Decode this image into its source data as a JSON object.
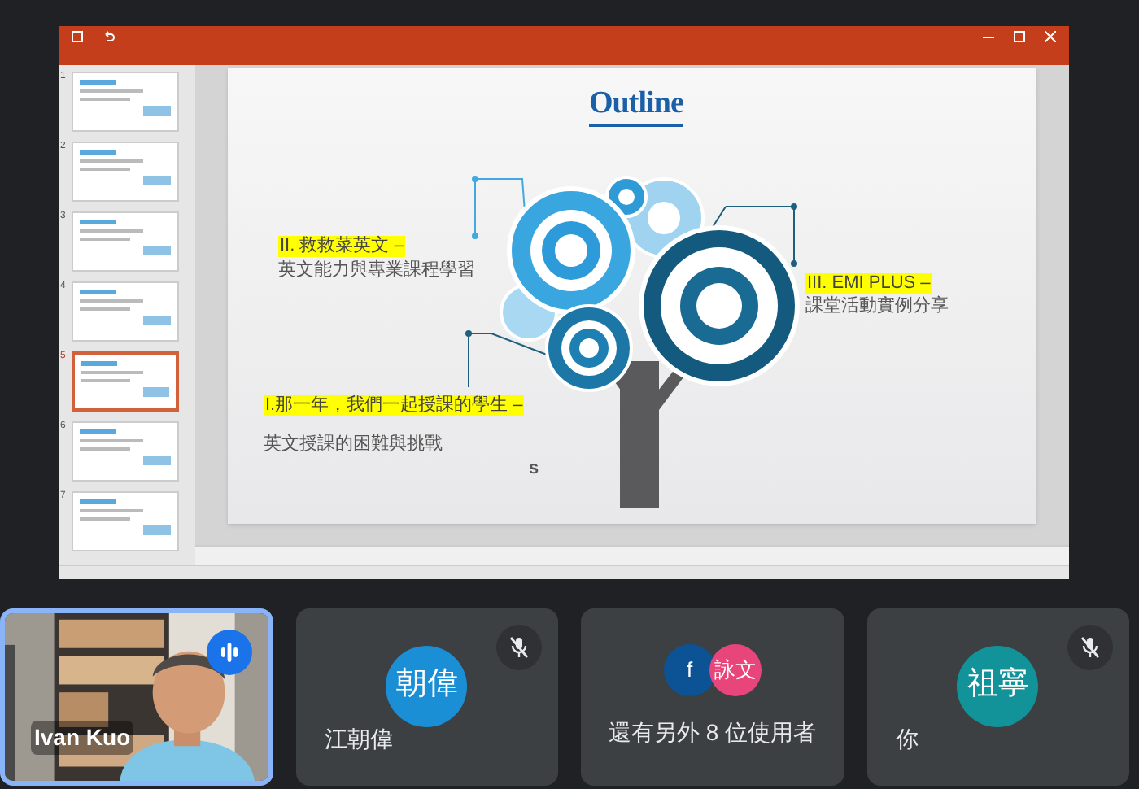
{
  "presentation": {
    "thumbnails": [
      {
        "number": "1",
        "selected": false
      },
      {
        "number": "2",
        "selected": false
      },
      {
        "number": "3",
        "selected": false
      },
      {
        "number": "4",
        "selected": false
      },
      {
        "number": "5",
        "selected": true
      },
      {
        "number": "6",
        "selected": false
      },
      {
        "number": "7",
        "selected": false
      }
    ],
    "slide": {
      "title": "Outline",
      "items": [
        {
          "text": "II.  救救菜英文  –",
          "highlighted": true
        },
        {
          "text": "英文能力與專業課程學習",
          "highlighted": false
        },
        {
          "text": "III. EMI PLUS –",
          "highlighted": true
        },
        {
          "text": "課堂活動實例分享",
          "highlighted": false
        },
        {
          "text": "I.那一年，我們一起授課的學生  –",
          "highlighted": true
        },
        {
          "text": "英文授課的困難與挑戰",
          "highlighted": false
        },
        {
          "text": "s",
          "highlighted": false
        }
      ]
    }
  },
  "tiles": [
    {
      "kind": "video",
      "name": "Ivan Kuo",
      "speaking": true,
      "muted": false
    },
    {
      "kind": "avatar",
      "avatar": "朝偉",
      "color": "#1a8fd6",
      "name": "江朝偉",
      "speaking": false,
      "muted": true
    },
    {
      "kind": "group",
      "avatars": [
        {
          "text": "f",
          "color": "#0b5394"
        },
        {
          "text": "詠文",
          "color": "#e8457b"
        }
      ],
      "label": "還有另外 8 位使用者",
      "speaking": false,
      "muted": false
    },
    {
      "kind": "avatar",
      "avatar": "祖寧",
      "color": "#12939a",
      "name": "你",
      "speaking": false,
      "muted": true
    }
  ]
}
